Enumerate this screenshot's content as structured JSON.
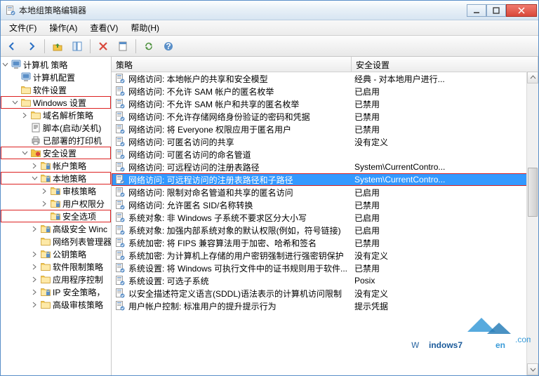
{
  "window": {
    "title": "本地组策略编辑器"
  },
  "menu": {
    "file": "文件(F)",
    "action": "操作(A)",
    "view": "查看(V)",
    "help": "帮助(H)"
  },
  "tree": [
    {
      "depth": 0,
      "tw": "open",
      "icon": "computer",
      "label": "计算机 策略",
      "hl": false
    },
    {
      "depth": 1,
      "tw": "none",
      "icon": "computer",
      "label": "计算机配置",
      "hl": false
    },
    {
      "depth": 1,
      "tw": "none",
      "icon": "folder",
      "label": "软件设置",
      "hl": false
    },
    {
      "depth": 1,
      "tw": "open",
      "icon": "folder",
      "label": "Windows 设置",
      "hl": true
    },
    {
      "depth": 2,
      "tw": "closed",
      "icon": "folder",
      "label": "域名解析策略",
      "hl": false
    },
    {
      "depth": 2,
      "tw": "none",
      "icon": "script",
      "label": "脚本(启动/关机)",
      "hl": false
    },
    {
      "depth": 2,
      "tw": "none",
      "icon": "printer",
      "label": "已部署的打印机",
      "hl": false
    },
    {
      "depth": 2,
      "tw": "open",
      "icon": "security",
      "label": "安全设置",
      "hl": true
    },
    {
      "depth": 3,
      "tw": "closed",
      "icon": "folder-lock",
      "label": "帐户策略",
      "hl": false
    },
    {
      "depth": 3,
      "tw": "open",
      "icon": "folder-lock",
      "label": "本地策略",
      "hl": true
    },
    {
      "depth": 4,
      "tw": "closed",
      "icon": "folder-lock",
      "label": "审核策略",
      "hl": false
    },
    {
      "depth": 4,
      "tw": "closed",
      "icon": "folder-lock",
      "label": "用户权限分",
      "hl": false
    },
    {
      "depth": 4,
      "tw": "none",
      "icon": "folder-lock",
      "label": "安全选项",
      "hl": true
    },
    {
      "depth": 3,
      "tw": "closed",
      "icon": "firewall",
      "label": "高级安全 Winc",
      "hl": false
    },
    {
      "depth": 3,
      "tw": "none",
      "icon": "folder",
      "label": "网络列表管理器",
      "hl": false
    },
    {
      "depth": 3,
      "tw": "closed",
      "icon": "folder-key",
      "label": "公钥策略",
      "hl": false
    },
    {
      "depth": 3,
      "tw": "closed",
      "icon": "folder",
      "label": "软件限制策略",
      "hl": false
    },
    {
      "depth": 3,
      "tw": "closed",
      "icon": "folder",
      "label": "应用程序控制",
      "hl": false
    },
    {
      "depth": 3,
      "tw": "closed",
      "icon": "ipsec",
      "label": "IP 安全策略，",
      "hl": false
    },
    {
      "depth": 3,
      "tw": "closed",
      "icon": "folder",
      "label": "高级审核策略",
      "hl": false
    }
  ],
  "columns": {
    "policy": "策略",
    "security": "安全设置"
  },
  "rows": [
    {
      "p": "网络访问: 本地帐户的共享和安全模型",
      "s": "经典 - 对本地用户进行...",
      "sel": false
    },
    {
      "p": "网络访问: 不允许 SAM 帐户的匿名枚举",
      "s": "已启用",
      "sel": false
    },
    {
      "p": "网络访问: 不允许 SAM 帐户和共享的匿名枚举",
      "s": "已禁用",
      "sel": false
    },
    {
      "p": "网络访问: 不允许存储网络身份验证的密码和凭据",
      "s": "已禁用",
      "sel": false
    },
    {
      "p": "网络访问: 将 Everyone 权限应用于匿名用户",
      "s": "已禁用",
      "sel": false
    },
    {
      "p": "网络访问: 可匿名访问的共享",
      "s": "没有定义",
      "sel": false
    },
    {
      "p": "网络访问: 可匿名访问的命名管道",
      "s": "",
      "sel": false
    },
    {
      "p": "网络访问: 可远程访问的注册表路径",
      "s": "System\\CurrentContro...",
      "sel": false
    },
    {
      "p": "网络访问: 可远程访问的注册表路径和子路径",
      "s": "System\\CurrentContro...",
      "sel": true
    },
    {
      "p": "网络访问: 限制对命名管道和共享的匿名访问",
      "s": "已启用",
      "sel": false
    },
    {
      "p": "网络访问: 允许匿名 SID/名称转换",
      "s": "已禁用",
      "sel": false
    },
    {
      "p": "系统对象: 非 Windows 子系统不要求区分大小写",
      "s": "已启用",
      "sel": false
    },
    {
      "p": "系统对象: 加强内部系统对象的默认权限(例如，符号链接)",
      "s": "已启用",
      "sel": false
    },
    {
      "p": "系统加密: 将 FIPS 兼容算法用于加密、哈希和签名",
      "s": "已禁用",
      "sel": false
    },
    {
      "p": "系统加密: 为计算机上存储的用户密钥强制进行强密钥保护",
      "s": "没有定义",
      "sel": false
    },
    {
      "p": "系统设置: 将 Windows 可执行文件中的证书规则用于软件...",
      "s": "已禁用",
      "sel": false
    },
    {
      "p": "系统设置: 可选子系统",
      "s": "Posix",
      "sel": false
    },
    {
      "p": "以安全描述符定义语言(SDDL)语法表示的计算机访问限制",
      "s": "没有定义",
      "sel": false
    },
    {
      "p": "用户帐户控制: 标准用户的提升提示行为",
      "s": "提示凭据",
      "sel": false
    }
  ],
  "watermark": "Windows7en"
}
